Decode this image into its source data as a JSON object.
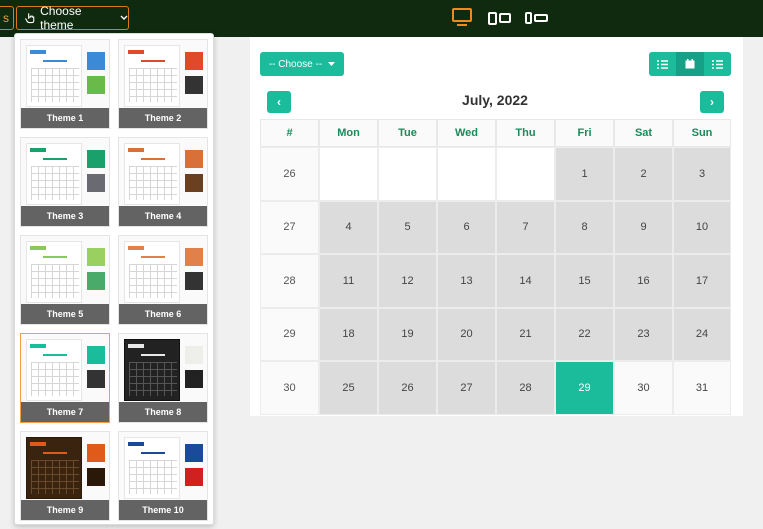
{
  "toolbar": {
    "left_stub": "s",
    "choose_theme_label": "Choose theme",
    "hand_icon": "hand-pointer-icon",
    "caret_icon": "chevron-down-icon",
    "devices": [
      "desktop-icon",
      "tablet-icon",
      "phone-icon"
    ],
    "active_device": "desktop"
  },
  "colors": {
    "topbar": "#0f2a0f",
    "accent": "#1abc9c",
    "accent_dark": "#16a085",
    "orange": "#f08a1a",
    "header_text": "#1a8a5a"
  },
  "themes": [
    {
      "label": "Theme 1",
      "header": "#3a8ad8",
      "sw1": "#3a8ad8",
      "sw2": "#6aba4a"
    },
    {
      "label": "Theme 2",
      "header": "#e04a2a",
      "sw1": "#e04a2a",
      "sw2": "#333333"
    },
    {
      "label": "Theme 3",
      "header": "#1aa06a",
      "sw1": "#1aa06a",
      "sw2": "#6a6a72"
    },
    {
      "label": "Theme 4",
      "header": "#d8703a",
      "sw1": "#d8703a",
      "sw2": "#6a4020"
    },
    {
      "label": "Theme 5",
      "header": "#8ac85a",
      "sw1": "#9ad060",
      "sw2": "#4aaa6a"
    },
    {
      "label": "Theme 6",
      "header": "#e0804a",
      "sw1": "#e0804a",
      "sw2": "#333333"
    },
    {
      "label": "Theme 7",
      "header": "#1abc9c",
      "sw1": "#1abc9c",
      "sw2": "#333333"
    },
    {
      "label": "Theme 8",
      "header": "#e8e8e8",
      "sw1": "#eeeeea",
      "sw2": "#222222"
    },
    {
      "label": "Theme 9",
      "header": "#e05a1a",
      "sw1": "#e05a1a",
      "sw2": "#2a1808"
    },
    {
      "label": "Theme 10",
      "header": "#1a4a9a",
      "sw1": "#1a4a9a",
      "sw2": "#d02020"
    }
  ],
  "selected_theme": "Theme 7",
  "calendar": {
    "choose_label": "-- Choose --",
    "month_title": "July, 2022",
    "prev_label": "‹",
    "next_label": "›",
    "view_icons": [
      "list-icon",
      "calendar-icon",
      "list-icon"
    ],
    "headers": [
      "#",
      "Mon",
      "Tue",
      "Wed",
      "Thu",
      "Fri",
      "Sat",
      "Sun"
    ],
    "weeks": [
      {
        "wk": "26",
        "days": [
          "",
          "",
          "",
          "",
          "1",
          "2",
          "3"
        ]
      },
      {
        "wk": "27",
        "days": [
          "4",
          "5",
          "6",
          "7",
          "8",
          "9",
          "10"
        ]
      },
      {
        "wk": "28",
        "days": [
          "11",
          "12",
          "13",
          "14",
          "15",
          "16",
          "17"
        ]
      },
      {
        "wk": "29",
        "days": [
          "18",
          "19",
          "20",
          "21",
          "22",
          "23",
          "24"
        ]
      },
      {
        "wk": "30",
        "days": [
          "25",
          "26",
          "27",
          "28",
          "29",
          "30",
          "31"
        ]
      }
    ],
    "today": "29"
  }
}
